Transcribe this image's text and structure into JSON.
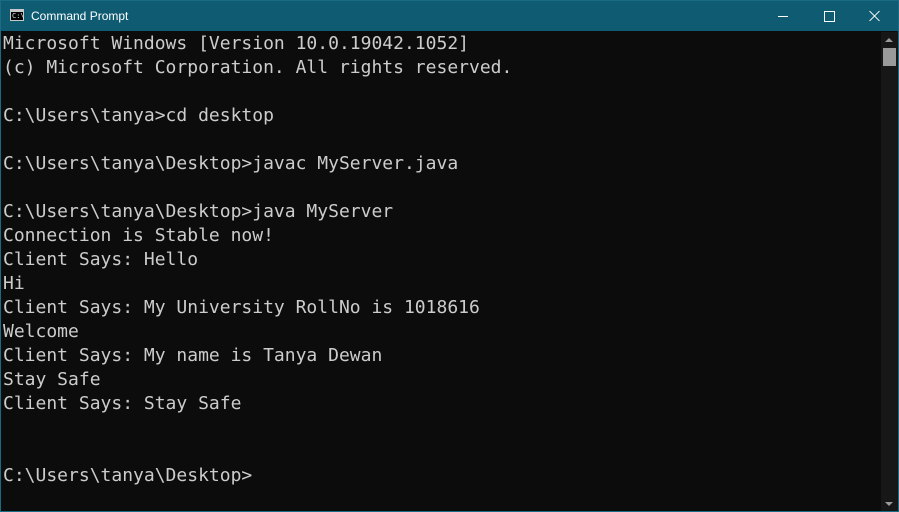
{
  "window": {
    "title": "Command Prompt",
    "icon": "console-icon",
    "icon_label": "C:\\",
    "controls": [
      "minimize-icon",
      "maximize-icon",
      "close-icon"
    ]
  },
  "console": {
    "lines": [
      "Microsoft Windows [Version 10.0.19042.1052]",
      "(c) Microsoft Corporation. All rights reserved.",
      "",
      "C:\\Users\\tanya>cd desktop",
      "",
      "C:\\Users\\tanya\\Desktop>javac MyServer.java",
      "",
      "C:\\Users\\tanya\\Desktop>java MyServer",
      "Connection is Stable now!",
      "Client Says: Hello",
      "Hi",
      "Client Says: My University RollNo is 1018616",
      "Welcome",
      "Client Says: My name is Tanya Dewan",
      "Stay Safe",
      "Client Says: Stay Safe",
      "",
      "",
      "C:\\Users\\tanya\\Desktop>"
    ]
  },
  "colors": {
    "titlebar": "#0f5b72",
    "console_background": "#0c0c0c",
    "console_text": "#cccccc"
  }
}
